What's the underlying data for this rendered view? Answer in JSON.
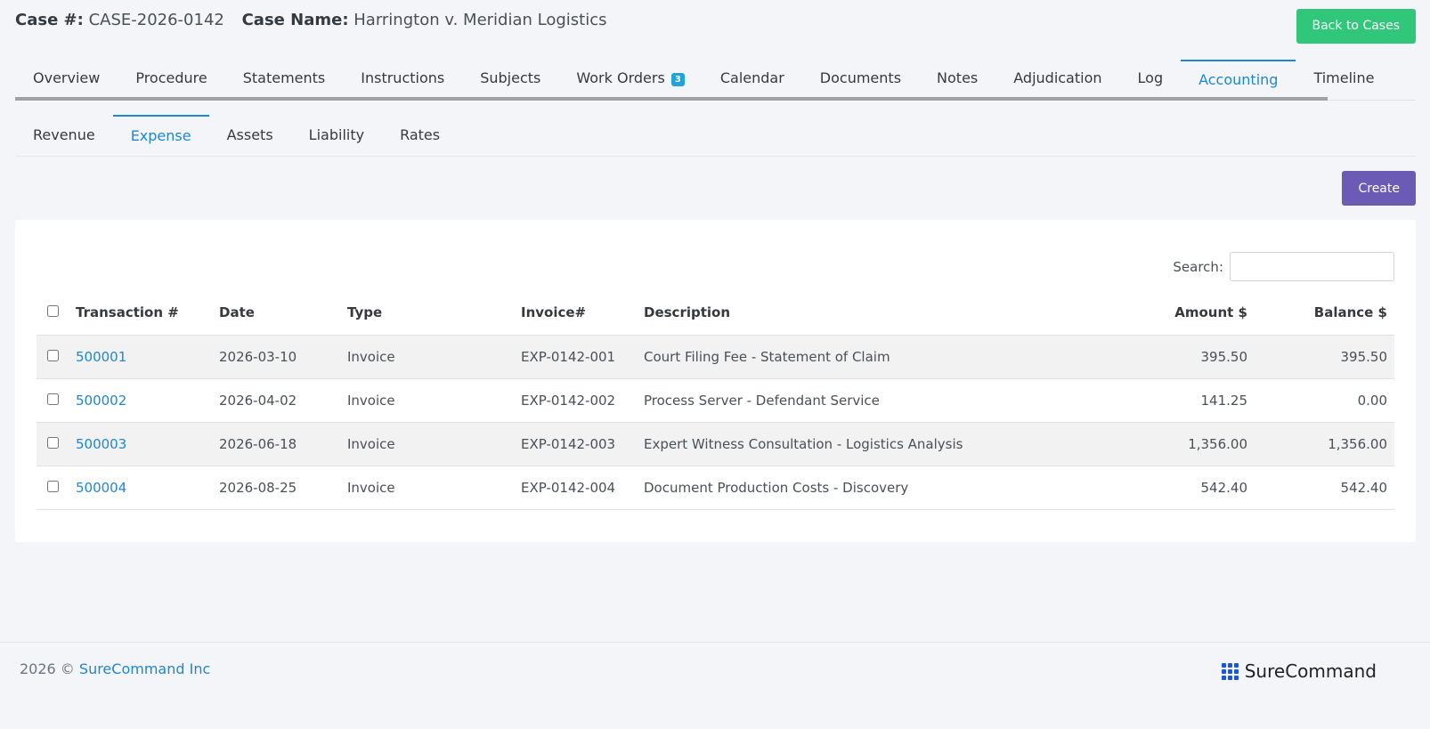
{
  "header": {
    "case_number_label": "Case #:",
    "case_number": "CASE-2026-0142",
    "case_name_label": "Case Name:",
    "case_name": "Harrington v. Meridian Logistics",
    "back_button": "Back to Cases"
  },
  "tabs": [
    {
      "label": "Overview"
    },
    {
      "label": "Procedure"
    },
    {
      "label": "Statements"
    },
    {
      "label": "Instructions"
    },
    {
      "label": "Subjects"
    },
    {
      "label": "Work Orders",
      "badge": "3"
    },
    {
      "label": "Calendar"
    },
    {
      "label": "Documents"
    },
    {
      "label": "Notes"
    },
    {
      "label": "Adjudication"
    },
    {
      "label": "Log"
    },
    {
      "label": "Accounting",
      "active": true
    },
    {
      "label": "Timeline"
    }
  ],
  "subtabs": [
    {
      "label": "Revenue"
    },
    {
      "label": "Expense",
      "active": true
    },
    {
      "label": "Assets"
    },
    {
      "label": "Liability"
    },
    {
      "label": "Rates"
    }
  ],
  "create_button": "Create",
  "search": {
    "label": "Search:",
    "value": "",
    "placeholder": ""
  },
  "table": {
    "columns": [
      "Transaction #",
      "Date",
      "Type",
      "Invoice#",
      "Description",
      "Amount $",
      "Balance $"
    ],
    "rows": [
      {
        "transaction": "500001",
        "date": "2026-03-10",
        "type": "Invoice",
        "invoice": "EXP-0142-001",
        "description": "Court Filing Fee - Statement of Claim",
        "amount": "395.50",
        "balance": "395.50"
      },
      {
        "transaction": "500002",
        "date": "2026-04-02",
        "type": "Invoice",
        "invoice": "EXP-0142-002",
        "description": "Process Server - Defendant Service",
        "amount": "141.25",
        "balance": "0.00"
      },
      {
        "transaction": "500003",
        "date": "2026-06-18",
        "type": "Invoice",
        "invoice": "EXP-0142-003",
        "description": "Expert Witness Consultation - Logistics Analysis",
        "amount": "1,356.00",
        "balance": "1,356.00"
      },
      {
        "transaction": "500004",
        "date": "2026-08-25",
        "type": "Invoice",
        "invoice": "EXP-0142-004",
        "description": "Document Production Costs - Discovery",
        "amount": "542.40",
        "balance": "542.40"
      }
    ]
  },
  "footer": {
    "copyright_prefix": "2026 ©",
    "company_link": "SureCommand Inc",
    "brand": "SureCommand"
  },
  "colors": {
    "accent": "#1f86d4",
    "back_button": "#30c77a",
    "create_button": "#6b5bb5",
    "badge": "#1fa3d8",
    "brand_logo": "#1a56d6"
  }
}
